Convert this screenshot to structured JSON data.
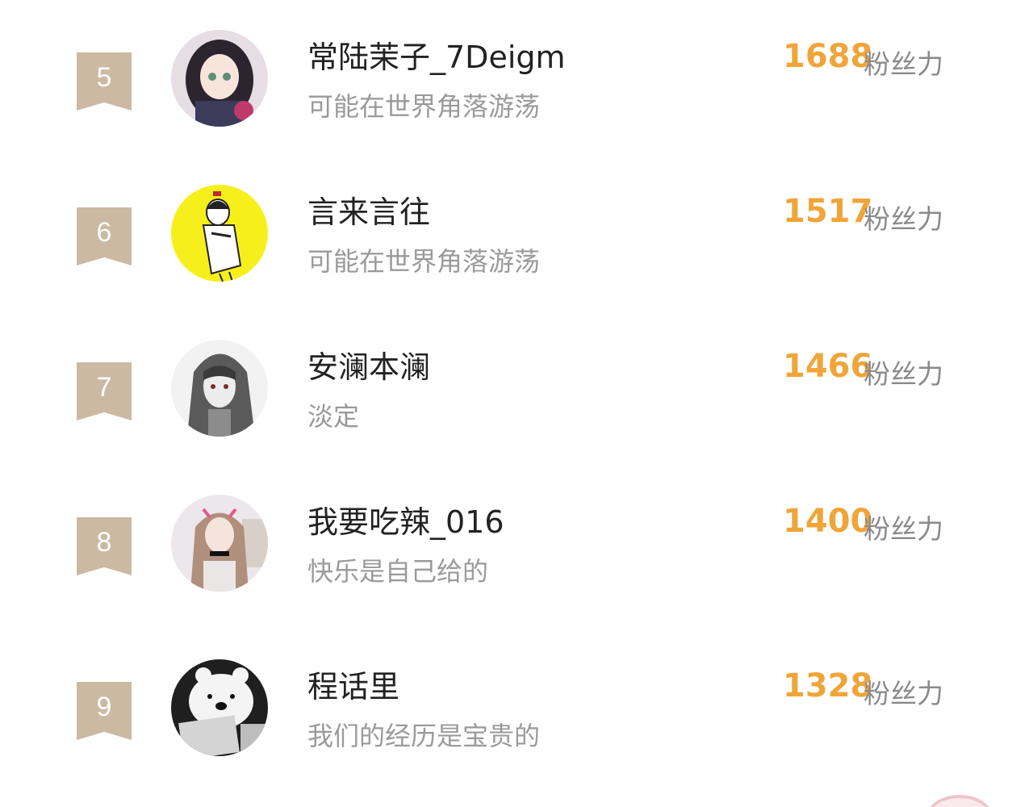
{
  "ranking": {
    "score_unit": "粉丝力",
    "items": [
      {
        "rank": "5",
        "name": "常陆茉子_7Deigm",
        "signature": "可能在世界角落游荡",
        "score": "1688"
      },
      {
        "rank": "6",
        "name": "言来言往",
        "signature": "可能在世界角落游荡",
        "score": "1517"
      },
      {
        "rank": "7",
        "name": "安澜本澜",
        "signature": "淡定",
        "score": "1466"
      },
      {
        "rank": "8",
        "name": "我要吃辣_016",
        "signature": "快乐是自己给的",
        "score": "1400"
      },
      {
        "rank": "9",
        "name": "程话里",
        "signature": "我们的经历是宝贵的",
        "score": "1328"
      }
    ]
  },
  "colors": {
    "rank_badge": "#cbb9a2",
    "score": "#f0a53a",
    "name": "#222222",
    "signature": "#9a9a9a"
  },
  "avatar_icons": [
    "anime-girl-avatar-icon",
    "yellow-cartoon-boy-avatar-icon",
    "grayscale-anime-avatar-icon",
    "photo-girl-avatar-icon",
    "robot-bear-avatar-icon"
  ]
}
